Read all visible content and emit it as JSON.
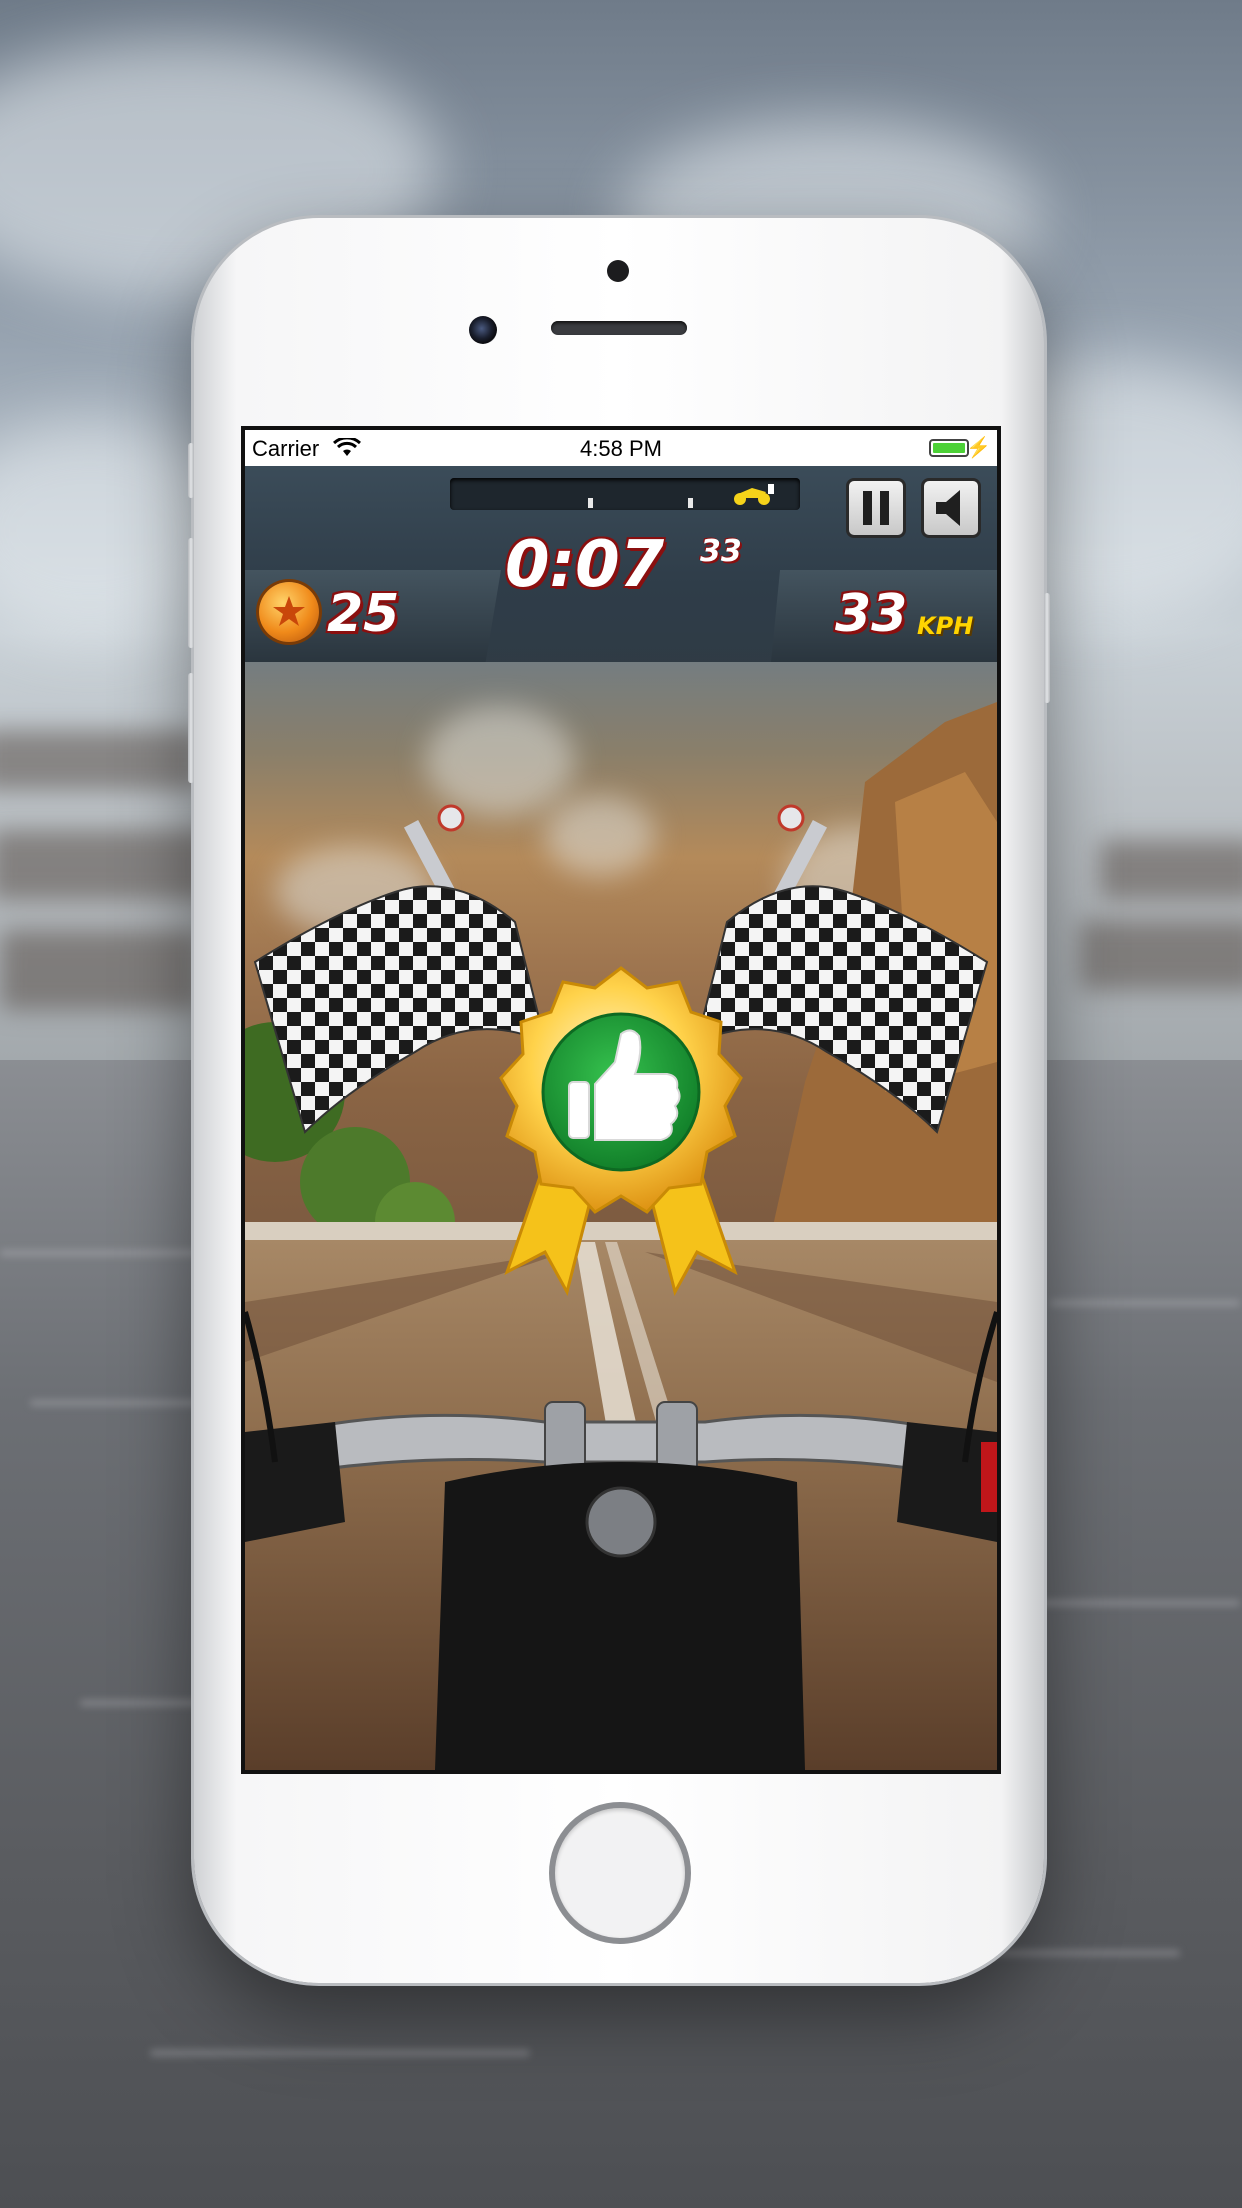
{
  "status_bar": {
    "carrier": "Carrier",
    "time": "4:58 PM"
  },
  "hud": {
    "timer_main": "0:07",
    "timer_fraction": "33",
    "coins": "25",
    "speed": "33",
    "speed_unit": "KPH",
    "progress_fraction": 0.92
  },
  "icons": {
    "pause": "pause-icon",
    "sound": "speaker-icon",
    "coin": "coin-icon",
    "badge": "thumbs-up-icon",
    "flags": "checkered-flag-icon"
  },
  "colors": {
    "badge_green": "#1fa33a",
    "badge_gold": "#f5b51a",
    "text_outline_red": "#8a0f0f",
    "unit_yellow": "#ffd400"
  }
}
